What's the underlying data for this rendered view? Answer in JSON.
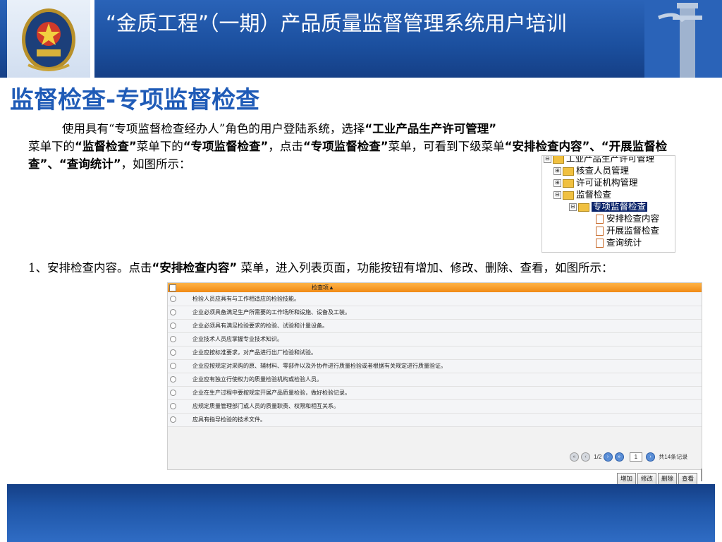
{
  "header": {
    "title": "“金质工程”（一期）产品质量监督管理系统用户培训"
  },
  "slide": {
    "subtitle": "监督检查-专项监督检查",
    "para1": {
      "t1": "使用具有“专项监督检查经办人”角色的用户登陆系统，选择",
      "b1": "“工业产品生产许可管理”",
      "t2": "菜单下的",
      "b2": "“监督检查”",
      "t3": "菜单下的",
      "b3": "“专项监督检查”",
      "t4": "，点击",
      "b4": "“专项监督检查”",
      "t5": "菜单，可看到下级菜单",
      "b5": "“安排检查内容”、“开展监督检查”、“查询统计”",
      "t6": "，如图所示："
    },
    "para2": {
      "t1": "1、安排检查内容。点击",
      "b1": "“安排检查内容”",
      "t2": " 菜单，进入列表页面，功能按钮有增加、修改、删除、查看，如图所示："
    }
  },
  "tree": {
    "items": [
      {
        "label": "工业产品生产许可管理",
        "expander": "⊟",
        "icon": "folder-icon"
      },
      {
        "label": "核查人员管理",
        "expander": "⊞",
        "icon": "folder-icon"
      },
      {
        "label": "许可证机构管理",
        "expander": "⊞",
        "icon": "folder-icon"
      },
      {
        "label": "监督检查",
        "expander": "⊟",
        "icon": "folder-icon"
      },
      {
        "label": "专项监督检查",
        "expander": "⊟",
        "icon": "folder-icon"
      },
      {
        "label": "安排检查内容",
        "icon": "document-icon"
      },
      {
        "label": "开展监督检查",
        "icon": "document-icon"
      },
      {
        "label": "查询统计",
        "icon": "document-icon"
      }
    ]
  },
  "grid": {
    "header_label": "检查项▲",
    "rows": [
      "检验人员应具有与工作相适应的检验技能。",
      "企业必须具备满足生产所需要的工作场所和设施、设备及工装。",
      "企业必须具有满足检验要求的检验、试验和计量设备。",
      "企业技术人员应掌握专业技术知识。",
      "企业应按标准要求，对产品进行出厂检验和试验。",
      "企业应按规定对采购的原、辅材料、零部件以及外协件进行质量检验或者根据有关规定进行质量验证。",
      "企业应有独立行使权力的质量检验机构或检验人员。",
      "企业在生产过程中要按规定开展产品质量检验，做好检验记录。",
      "应规定质量管理部门或人员的质量职责、权限和相互关系。",
      "应具有指导检验的技术文件。"
    ],
    "pager": {
      "page": "1/2",
      "input_value": "1",
      "total": "共14条记录"
    },
    "buttons": [
      "增加",
      "修改",
      "删除",
      "查看"
    ]
  }
}
